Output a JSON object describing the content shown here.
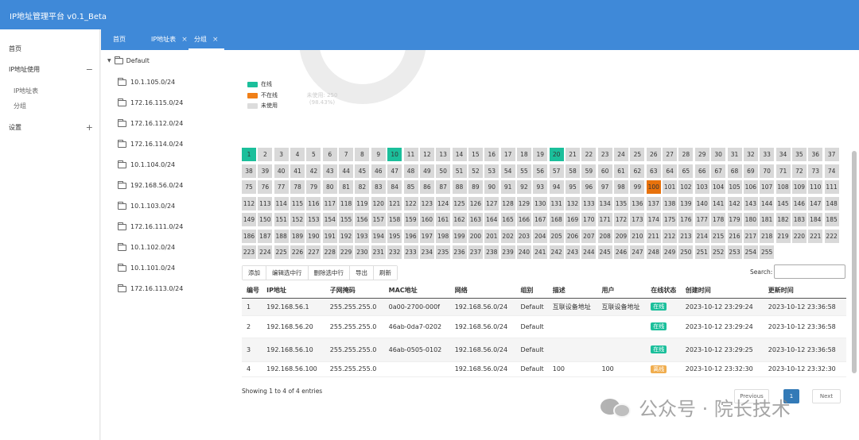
{
  "app": {
    "title": "IP地址管理平台 v0.1_Beta"
  },
  "sidebar": {
    "items": [
      {
        "label": "首页"
      },
      {
        "label": "IP地址使用",
        "sign": "−",
        "children": [
          {
            "label": "IP地址表"
          },
          {
            "label": "分组"
          }
        ]
      },
      {
        "label": "设置",
        "sign": "+"
      }
    ]
  },
  "tabs": [
    {
      "label": "首页"
    },
    {
      "label": "IP地址表",
      "close": "×"
    },
    {
      "label": "分组",
      "close": "×",
      "active": true
    }
  ],
  "tree": {
    "root": "Default",
    "nodes": [
      "10.1.105.0/24",
      "172.16.115.0/24",
      "172.16.112.0/24",
      "172.16.114.0/24",
      "10.1.104.0/24",
      "192.168.56.0/24",
      "10.1.103.0/24",
      "172.16.111.0/24",
      "10.1.102.0/24",
      "10.1.101.0/24",
      "172.16.113.0/24"
    ]
  },
  "chart_data": {
    "type": "pie",
    "series": [
      {
        "name": "在线",
        "value": 3,
        "color": "#1bbf9b"
      },
      {
        "name": "不在线",
        "value": 1,
        "color": "#f07f18"
      },
      {
        "name": "未使用",
        "value": 250,
        "color": "#dcdcdc"
      }
    ],
    "visible_labels": [
      "未使用: 250",
      "(98.43%)"
    ]
  },
  "ip_grid": {
    "count": 255,
    "online": [
      1,
      10,
      20
    ],
    "offline": [
      100
    ],
    "colors": {
      "online": "#1bbf9b",
      "offline": "#e8720c",
      "unused": "#d9d9d9"
    }
  },
  "toolbar": {
    "buttons": [
      "添加",
      "编辑选中行",
      "删除选中行",
      "导出",
      "刷新"
    ]
  },
  "search": {
    "label": "Search:",
    "value": ""
  },
  "table": {
    "headers": [
      "编号",
      "IP地址",
      "子网掩码",
      "MAC地址",
      "网络",
      "组别",
      "描述",
      "用户",
      "在线状态",
      "创建时间",
      "更新时间"
    ],
    "rows": [
      {
        "id": "1",
        "ip": "192.168.56.1",
        "mask": "255.255.255.0",
        "mac": "0a00-2700-000f",
        "net": "192.168.56.0/24",
        "group": "Default",
        "desc": "互联设备地址",
        "user": "互联设备地址",
        "status": "在线",
        "status_color": "#1bbf9b",
        "created": "2023-10-12 23:29:24",
        "updated": "2023-10-12 23:36:58"
      },
      {
        "id": "2",
        "ip": "192.168.56.20",
        "mask": "255.255.255.0",
        "mac": "46ab-0da7-0202",
        "net": "192.168.56.0/24",
        "group": "Default",
        "desc": "",
        "user": "",
        "status": "在线",
        "status_color": "#1bbf9b",
        "created": "2023-10-12 23:29:24",
        "updated": "2023-10-12 23:36:58"
      },
      {
        "id": "3",
        "ip": "192.168.56.10",
        "mask": "255.255.255.0",
        "mac": "46ab-0505-0102",
        "net": "192.168.56.0/24",
        "group": "Default",
        "desc": "",
        "user": "",
        "status": "在线",
        "status_color": "#1bbf9b",
        "created": "2023-10-12 23:29:25",
        "updated": "2023-10-12 23:36:58"
      },
      {
        "id": "4",
        "ip": "192.168.56.100",
        "mask": "255.255.255.0",
        "mac": "",
        "net": "192.168.56.0/24",
        "group": "Default",
        "desc": "100",
        "user": "100",
        "status": "离线",
        "status_color": "#f0ad4e",
        "created": "2023-10-12 23:32:30",
        "updated": "2023-10-12 23:32:30"
      }
    ]
  },
  "footer": {
    "entries": "Showing 1 to 4 of 4 entries",
    "prev": "Previous",
    "page": "1",
    "next": "Next"
  },
  "watermark": {
    "text": "公众号 · 院长技术"
  }
}
